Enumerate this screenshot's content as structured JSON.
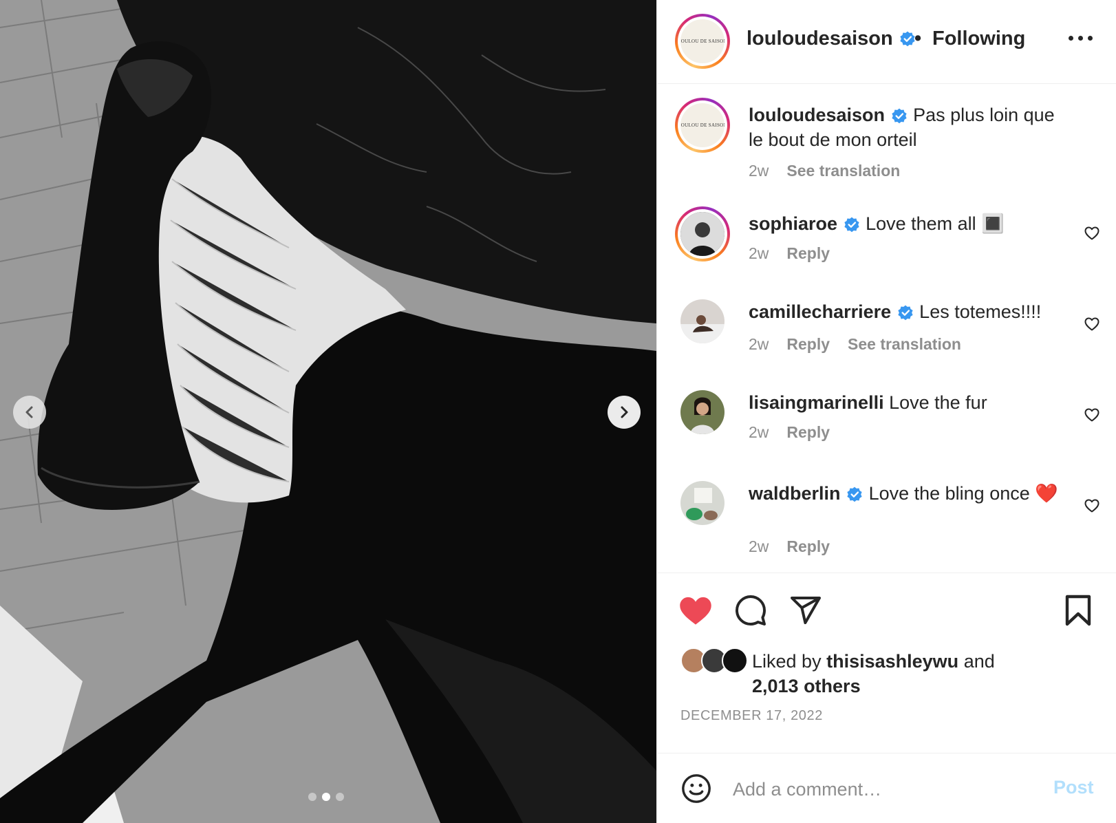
{
  "post": {
    "username": "louloudesaison",
    "follow_status": "Following",
    "separator": "•",
    "avatar_logo_text": "LOULOU DE SAISON",
    "caption": "Pas plus loin que le bout de mon orteil",
    "caption_time": "2w",
    "caption_translate": "See translation",
    "carousel": {
      "slide_count": 3,
      "active_slide": 2
    }
  },
  "comments": [
    {
      "username": "sophiaroe",
      "verified": true,
      "text": "Love them all",
      "emoji": "🔳",
      "time": "2w",
      "reply": "Reply",
      "translate": ""
    },
    {
      "username": "camillecharriere",
      "verified": true,
      "text": "Les totemes!!!!",
      "time": "2w",
      "reply": "Reply",
      "translate": "See translation"
    },
    {
      "username": "lisaingmarinelli",
      "verified": false,
      "text": "Love the fur",
      "time": "2w",
      "reply": "Reply",
      "translate": ""
    },
    {
      "username": "waldberlin",
      "verified": true,
      "text": "Love the bling once",
      "emoji": "❤️",
      "time": "2w",
      "reply": "Reply",
      "translate": ""
    }
  ],
  "actions": {
    "liked": true,
    "liked_by_prefix": "Liked by",
    "liked_by_user": "thisisashleywu",
    "liked_by_and": "and",
    "others": "2,013 others",
    "date": "DECEMBER 17, 2022"
  },
  "comment_box": {
    "placeholder": "Add a comment…",
    "post_label": "Post"
  },
  "colors": {
    "heart_red": "#ed4956",
    "verified_blue": "#3897f0",
    "post_disabled": "#b2dffc",
    "secondary_text": "#8e8e8e"
  }
}
